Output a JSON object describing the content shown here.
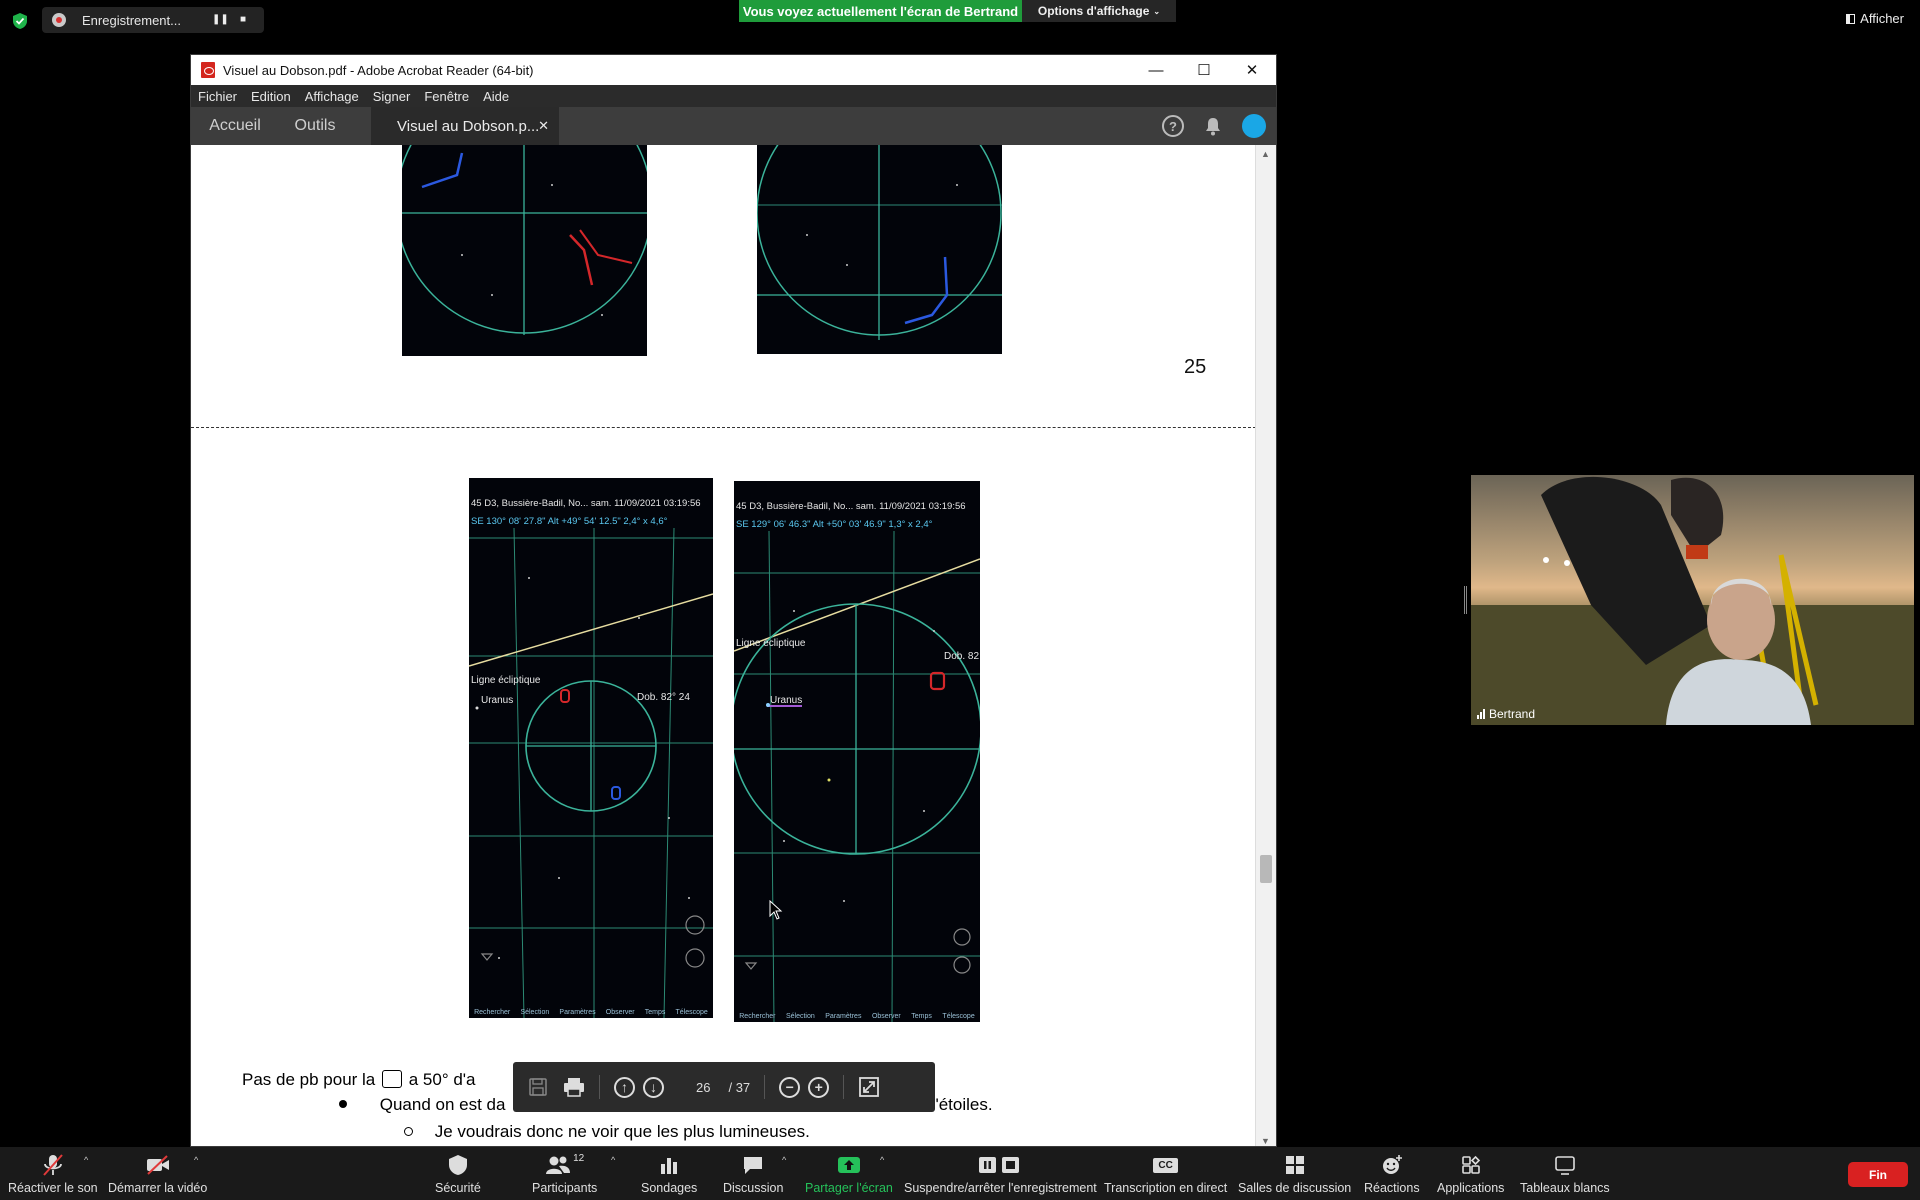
{
  "zoom": {
    "recording_label": "Enregistrement...",
    "share_banner": "Vous voyez actuellement l'écran de Bertrand",
    "view_options": "Options d'affichage",
    "show_button": "Afficher",
    "participant_name": "Bertrand",
    "participants_count": "12",
    "toolbar": {
      "unmute": "Réactiver le son",
      "start_video": "Démarrer la vidéo",
      "security": "Sécurité",
      "participants": "Participants",
      "polls": "Sondages",
      "chat": "Discussion",
      "share": "Partager l'écran",
      "pause_record": "Suspendre/arrêter l'enregistrement",
      "transcription": "Transcription en direct",
      "breakout": "Salles de discussion",
      "reactions": "Réactions",
      "apps": "Applications",
      "whiteboards": "Tableaux blancs",
      "end": "Fin",
      "cc": "CC"
    }
  },
  "acrobat": {
    "window_title": "Visuel au Dobson.pdf - Adobe Acrobat Reader (64-bit)",
    "menu": [
      "Fichier",
      "Edition",
      "Affichage",
      "Signer",
      "Fenêtre",
      "Aide"
    ],
    "tabs": {
      "home": "Accueil",
      "tools": "Outils",
      "doc": "Visuel au Dobson.p..."
    },
    "help_glyph": "?",
    "page_number_label": "25",
    "current_page": "26",
    "total_pages": "/ 37",
    "doc_lines": {
      "line1": "Pas de pb pour  la",
      "line1b": "a 50° d'a",
      "bullet1": "Quand on est da",
      "bullet1b": "d'étoiles.",
      "sub1": "Je voudrais donc ne voir que les plus lumineuses."
    },
    "skymap_left": {
      "header": "45 D3, Bussière-Badil, No...    sam. 11/09/2021  03:19:56",
      "coords": "SE  130° 08' 27.8\"  Alt +49° 54' 12.5\"        2,4° x 4,6°",
      "ecliptic": "Ligne écliptique",
      "planet": "Uranus",
      "dob": "Dob. 82° 24",
      "tools": [
        "Rechercher",
        "Sélection",
        "Paramètres",
        "Observer",
        "Temps",
        "Télescope"
      ]
    },
    "skymap_right": {
      "header": "45 D3, Bussière-Badil, No...    sam. 11/09/2021  03:19:56",
      "coords": "SE  129° 06' 46.3\"  Alt +50° 03' 46.9\"        1,3° x 2,4°",
      "ecliptic": "Ligne écliptique",
      "planet": "Uranus",
      "dob": "Dob. 82",
      "tools": [
        "Rechercher",
        "Sélection",
        "Paramètres",
        "Observer",
        "Temps",
        "Télescope"
      ]
    }
  },
  "colors": {
    "share_green": "#1f9c3b",
    "end_red": "#d92121",
    "grid": "#3bb39a",
    "ecliptic": "#e6dca0"
  }
}
